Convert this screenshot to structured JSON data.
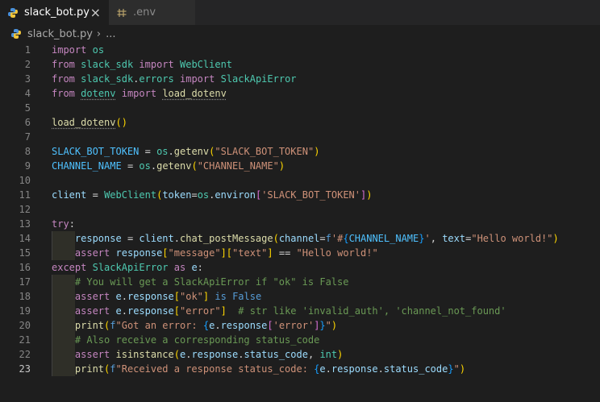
{
  "tabs": [
    {
      "label": "slack_bot.py",
      "icon": "python-icon",
      "active": true,
      "close": "×"
    },
    {
      "label": ".env",
      "icon": "env-file-icon",
      "active": false
    }
  ],
  "breadcrumb": {
    "file": "slack_bot.py",
    "separator": "›",
    "rest": "..."
  },
  "code": {
    "line_numbers": [
      "1",
      "2",
      "3",
      "4",
      "5",
      "6",
      "7",
      "8",
      "9",
      "10",
      "11",
      "12",
      "13",
      "14",
      "15",
      "16",
      "17",
      "18",
      "19",
      "20",
      "21",
      "22",
      "23"
    ],
    "current_line": "23"
  },
  "colors": {
    "keyword": "#c586c0",
    "function": "#dcdcaa",
    "class": "#4ec9b0",
    "variable": "#9cdcfe",
    "string": "#ce9178",
    "comment": "#6a9955",
    "background": "#1e1e1e"
  }
}
